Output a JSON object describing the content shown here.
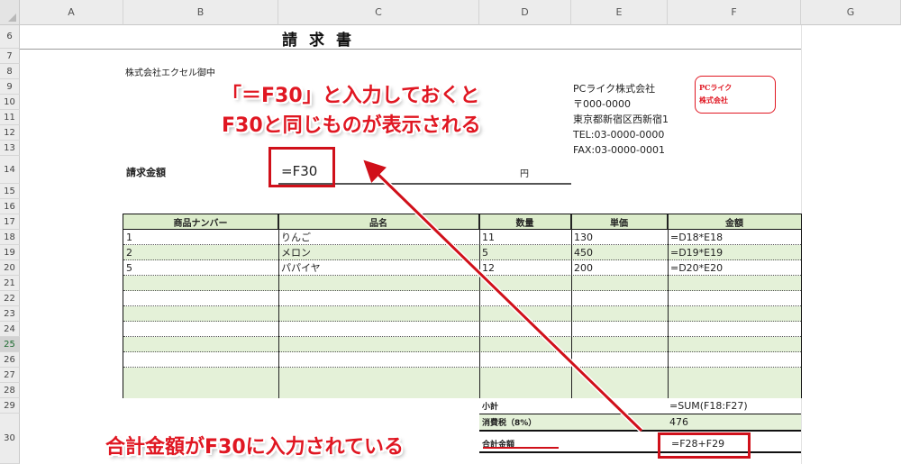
{
  "columns": [
    "A",
    "B",
    "C",
    "D",
    "E",
    "F",
    "G"
  ],
  "rows": [
    "6",
    "7",
    "8",
    "9",
    "10",
    "11",
    "12",
    "13",
    "14",
    "15",
    "16",
    "17",
    "18",
    "19",
    "20",
    "21",
    "22",
    "23",
    "24",
    "25",
    "26",
    "27",
    "28",
    "29",
    "30"
  ],
  "selected_row": "25",
  "document": {
    "title": "請求書",
    "customer": "株式会社エクセル御中",
    "amount_label": "請求金額",
    "amount_formula": "=F30",
    "yen": "円"
  },
  "company": {
    "name": "PCライク株式会社",
    "postal": "〒000-0000",
    "address": "東京都新宿区西新宿1-",
    "tel": "TEL:03-0000-0000",
    "fax": "FAX:03-0000-0001",
    "stamp_line1": "PCライク",
    "stamp_line2": "株式会社"
  },
  "table": {
    "headers": [
      "商品ナンバー",
      "品名",
      "数量",
      "単価",
      "金額"
    ],
    "rows": [
      [
        "1",
        "りんご",
        "11",
        "130",
        "=D18*E18"
      ],
      [
        "2",
        "メロン",
        "5",
        "450",
        "=D19*E19"
      ],
      [
        "5",
        "パパイヤ",
        "12",
        "200",
        "=D20*E20"
      ],
      [
        "",
        "",
        "",
        "",
        ""
      ],
      [
        "",
        "",
        "",
        "",
        ""
      ],
      [
        "",
        "",
        "",
        "",
        ""
      ],
      [
        "",
        "",
        "",
        "",
        ""
      ],
      [
        "",
        "",
        "",
        "",
        ""
      ],
      [
        "",
        "",
        "",
        "",
        ""
      ],
      [
        "",
        "",
        "",
        "",
        ""
      ]
    ]
  },
  "totals": [
    {
      "label": "小計",
      "value": "=SUM(F18:F27)"
    },
    {
      "label": "消費税（8%）",
      "value": "476"
    },
    {
      "label": "合計金額",
      "value": "=F28+F29"
    }
  ],
  "annotations": {
    "top_line1": "「＝F30」と入力しておくと",
    "top_line2": "F30と同じものが表示される",
    "bottom": "合計金額がF30に入力されている"
  },
  "colors": {
    "annotation_red": "#e01722",
    "table_green": "#e4f1d8",
    "header_green": "#dceccb"
  }
}
